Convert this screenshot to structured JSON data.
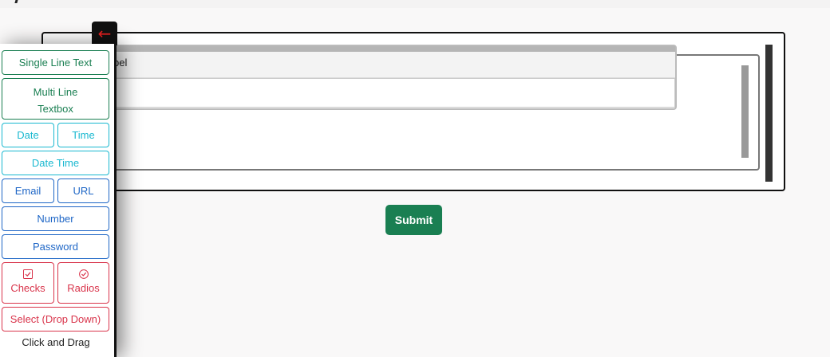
{
  "canvas": {
    "field_label": "bel",
    "submit_label": "Submit"
  },
  "toolbox": {
    "collapse_icon": "arrow-left-icon",
    "single_line": "Single Line Text",
    "multi_line_1": "Multi Line",
    "multi_line_2": "Textbox",
    "date": "Date",
    "time": "Time",
    "date_time": "Date Time",
    "email": "Email",
    "url": "URL",
    "number": "Number",
    "password": "Password",
    "checks": "Checks",
    "radios": "Radios",
    "select": "Select (Drop Down)",
    "hint": "Click and Drag"
  },
  "colors": {
    "green": "#1a7f52",
    "cyan": "#19b8d0",
    "blue": "#1e66c6",
    "red": "#d9344b"
  }
}
